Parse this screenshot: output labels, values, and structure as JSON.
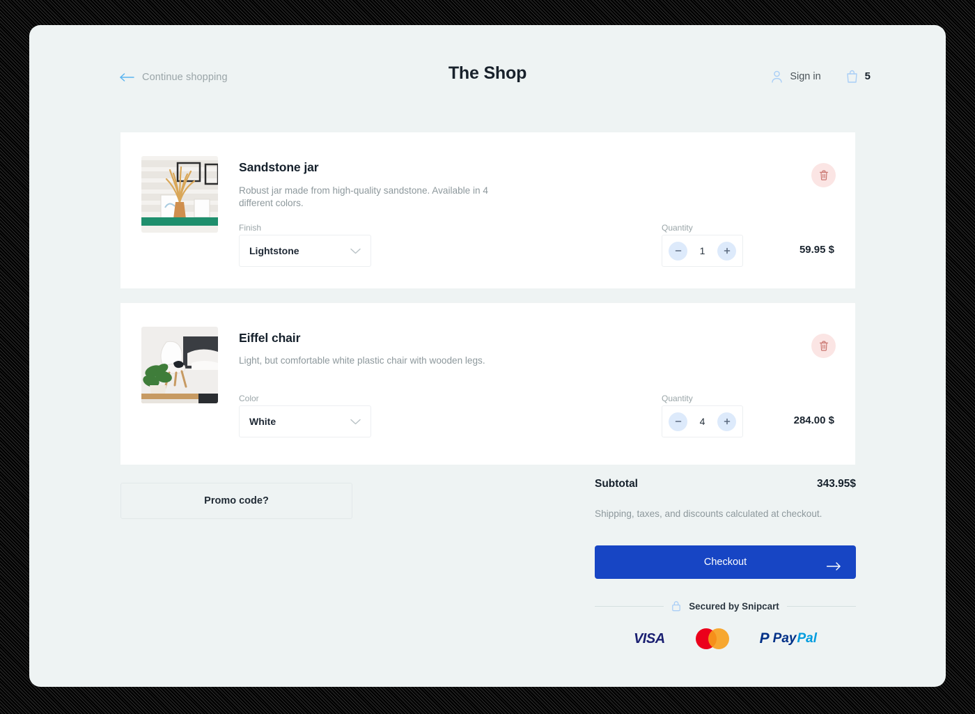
{
  "header": {
    "back_icon": "arrow-left-icon",
    "continue_label": "Continue shopping",
    "title": "The Shop",
    "signin_icon": "user-icon",
    "signin_label": "Sign in",
    "cart_icon": "shopping-bag-icon",
    "cart_count": "5"
  },
  "items": [
    {
      "title": "Sandstone jar",
      "description": "Robust jar made from high-quality sandstone. Available in 4 different colors.",
      "option_label": "Finish",
      "option_value": "Lightstone",
      "quantity_label": "Quantity",
      "quantity": "1",
      "price": "59.95 $",
      "remove_icon": "trash-icon",
      "decrement_icon": "minus-icon",
      "increment_icon": "plus-icon",
      "dropdown_icon": "chevron-down-icon",
      "image_alt": "sandstone-jar-photo"
    },
    {
      "title": "Eiffel chair",
      "description": "Light, but comfortable white plastic chair with wooden legs.",
      "option_label": "Color",
      "option_value": "White",
      "quantity_label": "Quantity",
      "quantity": "4",
      "price": "284.00 $",
      "remove_icon": "trash-icon",
      "decrement_icon": "minus-icon",
      "increment_icon": "plus-icon",
      "dropdown_icon": "chevron-down-icon",
      "image_alt": "eiffel-chair-photo"
    }
  ],
  "promo": {
    "label": "Promo code?"
  },
  "summary": {
    "subtotal_label": "Subtotal",
    "subtotal_value": "343.95$",
    "note": "Shipping, taxes, and discounts calculated at checkout.",
    "checkout_label": "Checkout",
    "checkout_arrow_icon": "arrow-right-icon"
  },
  "footer": {
    "lock_icon": "lock-icon",
    "secured_label": "Secured by Snipcart",
    "payments": {
      "visa": "VISA",
      "mastercard": "mastercard-logo",
      "paypal_mark": "P",
      "paypal_text1": "Pay",
      "paypal_text2": "Pal"
    }
  },
  "colors": {
    "page_background": "#eef3f3",
    "card_background": "#ffffff",
    "accent_blue": "#1745c4",
    "icon_blue": "#a9cef6",
    "link_blue": "#5ab4f0",
    "danger": "#c9756e",
    "muted_text": "#8d989c"
  }
}
